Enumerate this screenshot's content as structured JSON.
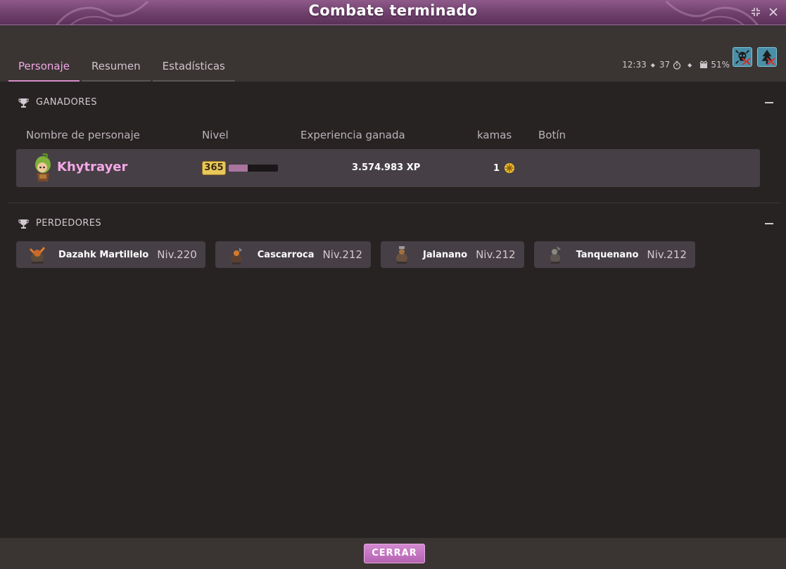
{
  "window": {
    "title": "Combate terminado"
  },
  "tabs": [
    {
      "label": "Personaje",
      "active": true
    },
    {
      "label": "Resumen",
      "active": false
    },
    {
      "label": "Estadísticas",
      "active": false
    }
  ],
  "info": {
    "time": "12:33",
    "turns": "37",
    "percent": "51%"
  },
  "winners": {
    "heading": "GANADORES",
    "columns": [
      "Nombre de personaje",
      "Nivel",
      "Experiencia ganada",
      "kamas",
      "Botín"
    ],
    "rows": [
      {
        "name": "Khytrayer",
        "level": "365",
        "level_progress": 0.38,
        "xp": "3.574.983",
        "xp_unit": "XP",
        "kamas": "1"
      }
    ]
  },
  "losers": {
    "heading": "PERDEDORES",
    "items": [
      {
        "name": "Dazahk Martillelo",
        "level": "Niv.220"
      },
      {
        "name": "Cascarroca",
        "level": "Niv.212"
      },
      {
        "name": "Jalanano",
        "level": "Niv.212"
      },
      {
        "name": "Tanquenano",
        "level": "Niv.212"
      }
    ]
  },
  "footer": {
    "close_label": "CERRAR"
  },
  "colors": {
    "accent": "#d78ccc",
    "title_bar": "#7a4876",
    "player_name": "#f5a8e8",
    "mode_button": "#4a8fa8"
  }
}
